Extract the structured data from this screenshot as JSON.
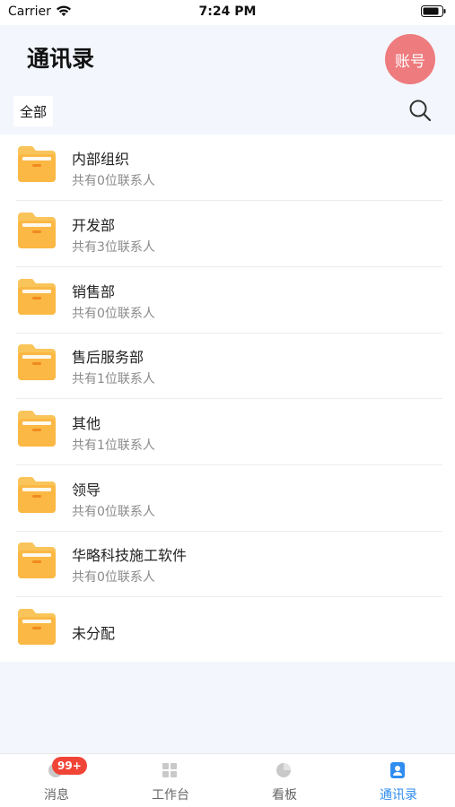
{
  "status_bar": {
    "carrier": "Carrier",
    "time": "7:24 PM"
  },
  "header": {
    "title": "通讯录",
    "account_label": "账号",
    "filter_label": "全部"
  },
  "colors": {
    "accent": "#2f8df0",
    "account": "#ee7b7e",
    "badge": "#f04437",
    "folder": "#fbbd4b"
  },
  "departments": [
    {
      "name": "内部组织",
      "count": "共有0位联系人"
    },
    {
      "name": "开发部",
      "count": "共有3位联系人"
    },
    {
      "name": "销售部",
      "count": "共有0位联系人"
    },
    {
      "name": "售后服务部",
      "count": "共有1位联系人"
    },
    {
      "name": "其他",
      "count": "共有1位联系人"
    },
    {
      "name": "领导",
      "count": "共有0位联系人"
    },
    {
      "name": "华略科技施工软件",
      "count": "共有0位联系人"
    },
    {
      "name": "未分配"
    }
  ],
  "tabs": [
    {
      "label": "消息",
      "icon": "message-icon",
      "badge": "99+"
    },
    {
      "label": "工作台",
      "icon": "grid-icon"
    },
    {
      "label": "看板",
      "icon": "pie-icon"
    },
    {
      "label": "通讯录",
      "icon": "contacts-icon",
      "active": true
    }
  ]
}
